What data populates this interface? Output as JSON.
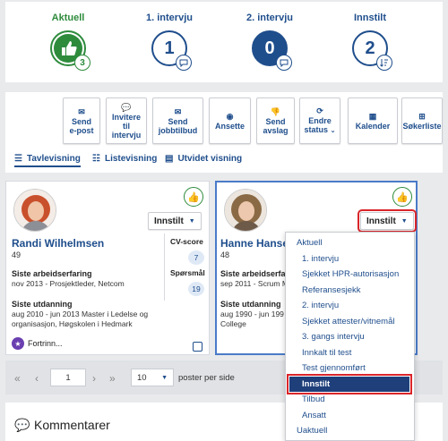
{
  "stages": [
    {
      "label": "Aktuell",
      "icon": "thumbs-up-icon",
      "badge": "3",
      "label_color": "#2e8b3c"
    },
    {
      "label": "1. intervju",
      "number": "1",
      "badge_icon": "chat-icon",
      "label_color": "#1f4e8c"
    },
    {
      "label": "2. intervju",
      "number": "0",
      "badge_icon": "chat-icon",
      "label_color": "#1f4e8c"
    },
    {
      "label": "Innstilt",
      "number": "2",
      "badge_icon": "sort-list-icon",
      "label_color": "#1f4e8c"
    }
  ],
  "toolbar": {
    "buttons": [
      {
        "l1": "Send",
        "l2": "e-post",
        "icon": "envelope-icon"
      },
      {
        "l1": "Invitere",
        "l2": "til",
        "l3": "intervju",
        "icon": "chat-icon"
      },
      {
        "l1": "Send",
        "l2": "jobbtilbud",
        "icon": "envelope-open-icon"
      },
      {
        "l1": "Ansette",
        "icon": "eye-icon"
      },
      {
        "l1": "Send",
        "l2": "avslag",
        "icon": "thumbs-down-icon"
      },
      {
        "l1": "Endre",
        "l2": "status",
        "icon": "refresh-icon"
      },
      {
        "l1": "Kalender",
        "icon": "calendar-icon"
      },
      {
        "l1": "Søkerliste",
        "icon": "grid-icon"
      }
    ]
  },
  "views": {
    "tavle": "Tavlevisning",
    "liste": "Listevisning",
    "utvidet": "Utvidet visning"
  },
  "cards": [
    {
      "name": "Randi Wilhelmsen",
      "age": "49",
      "status": "Innstilt",
      "exp_heading": "Siste arbeidserfaring",
      "exp_text": "nov 2013 - Prosjektleder, Netcom",
      "edu_heading": "Siste utdanning",
      "edu_line1": "aug 2010 - jun 2013 Master i Ledelse og",
      "edu_line2": "organisasjon, Høgskolen i Hedmark",
      "cv_label": "CV-score",
      "cv_value": "7",
      "q_label": "Spørsmål",
      "q_value": "19",
      "footer": "Fortrinn..."
    },
    {
      "name": "Hanne Hansen",
      "age": "48",
      "status": "Innstilt",
      "exp_heading": "Siste arbeidserfaring",
      "exp_text": "sep 2011 - Scrum M",
      "edu_heading": "Siste utdanning",
      "edu_line1": "aug 1990 - jun 199",
      "edu_line2": "College"
    }
  ],
  "pager": {
    "page": "1",
    "per_page": "10",
    "per_page_label": "poster per side"
  },
  "comments": {
    "title": "Kommentarer"
  },
  "status_menu": {
    "items": [
      "Aktuell",
      "1. intervju",
      "Sjekket HPR-autorisasjon",
      "Referansesjekk",
      "2. intervju",
      "Sjekket attester/vitnemål",
      "3. gangs intervju",
      "Innkalt til test",
      "Test gjennomført",
      "Innstilt",
      "Tilbud",
      "Ansatt",
      "Uaktuell"
    ],
    "selected_index": 9
  },
  "colors": {
    "accent": "#1f4e8c",
    "green": "#2e8b3c",
    "highlight": "#d9252a"
  }
}
